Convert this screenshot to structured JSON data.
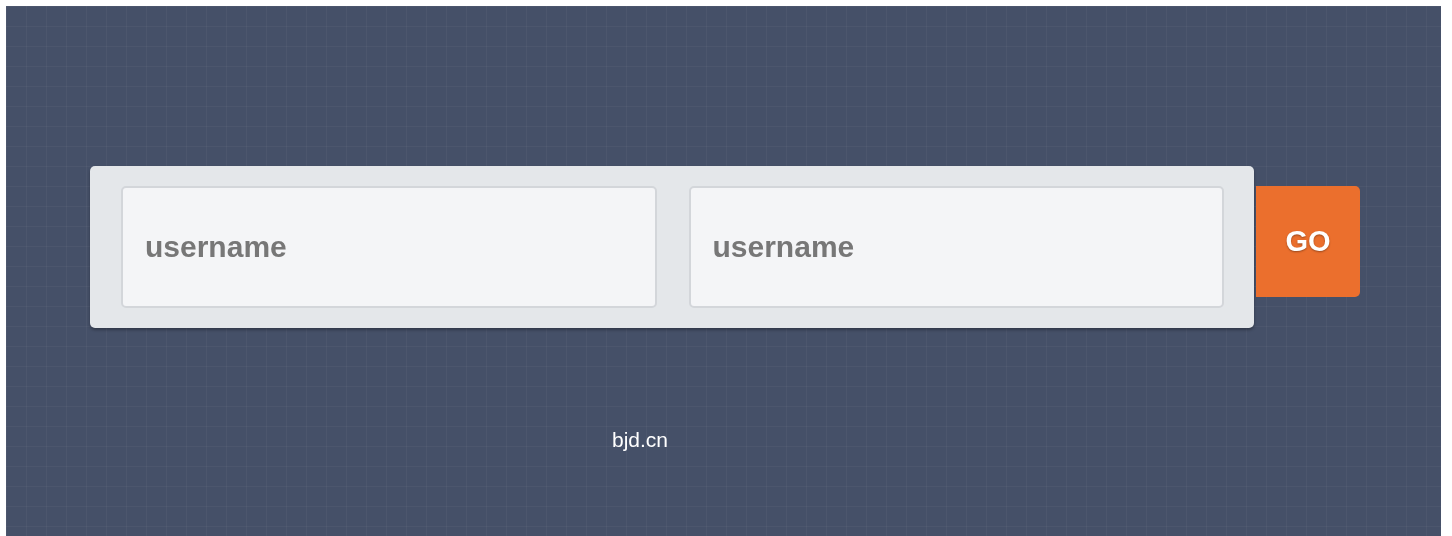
{
  "form": {
    "fields": [
      {
        "placeholder": "username"
      },
      {
        "placeholder": "username"
      }
    ],
    "button": {
      "label": "GO"
    }
  },
  "footer": {
    "text": "bjd.cn"
  }
}
